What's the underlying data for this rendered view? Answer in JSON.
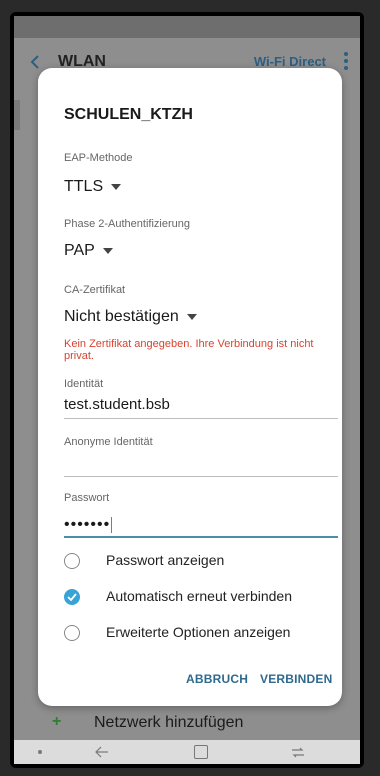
{
  "appbar": {
    "title": "WLAN",
    "wifi_direct": "Wi-Fi Direct"
  },
  "dialog": {
    "title": "SCHULEN_KTZH",
    "eap_method": {
      "label": "EAP-Methode",
      "value": "TTLS"
    },
    "phase2": {
      "label": "Phase 2-Authentifizierung",
      "value": "PAP"
    },
    "ca_cert": {
      "label": "CA-Zertifikat",
      "value": "Nicht bestätigen",
      "warning": "Kein Zertifikat angegeben. Ihre Verbindung ist nicht privat."
    },
    "identity": {
      "label": "Identität",
      "value": "test.student.bsb"
    },
    "anonymous_identity": {
      "label": "Anonyme Identität",
      "value": ""
    },
    "password": {
      "label": "Passwort",
      "value": "•••••••"
    },
    "options": [
      {
        "label": "Passwort anzeigen",
        "checked": false
      },
      {
        "label": "Automatisch erneut verbinden",
        "checked": true
      },
      {
        "label": "Erweiterte Optionen anzeigen",
        "checked": false
      }
    ],
    "cancel_label": "ABBRUCH",
    "connect_label": "VERBINDEN"
  },
  "add_network": {
    "label": "Netzwerk hinzufügen"
  },
  "colors": {
    "accent": "#39a3d6",
    "button_text": "#2e6a8e",
    "warning": "#d7432f"
  }
}
